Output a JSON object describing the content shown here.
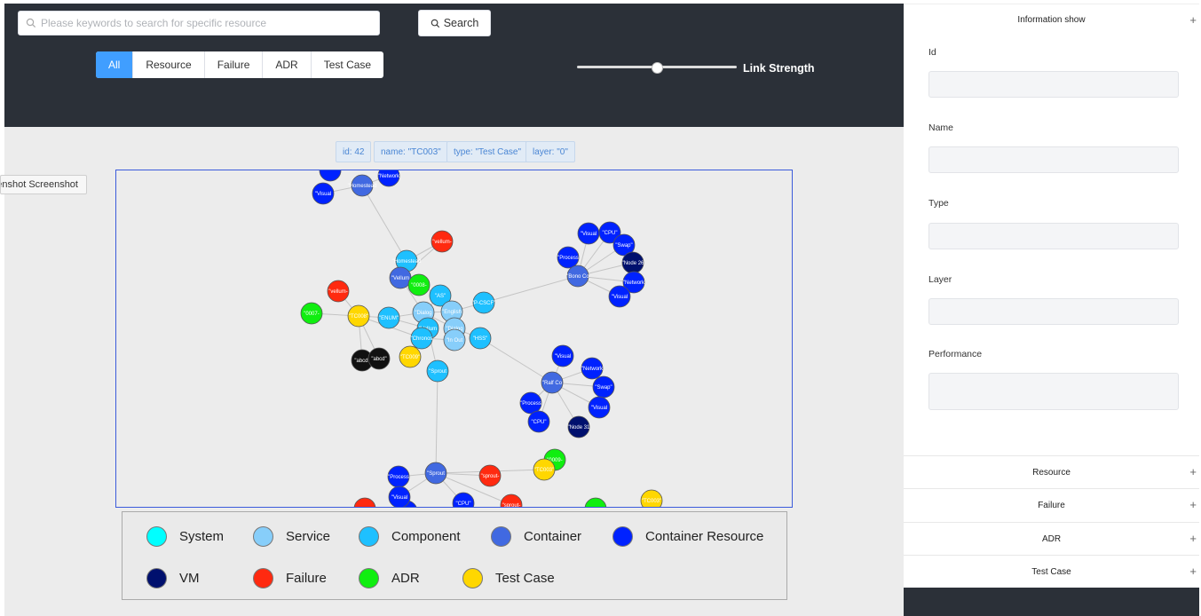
{
  "search": {
    "placeholder": "Please keywords to search for specific resource",
    "button_label": "Search"
  },
  "filter_tabs": [
    {
      "label": "All",
      "active": true
    },
    {
      "label": "Resource",
      "active": false
    },
    {
      "label": "Failure",
      "active": false
    },
    {
      "label": "ADR",
      "active": false
    },
    {
      "label": "Test Case",
      "active": false
    }
  ],
  "link_strength": {
    "label": "Link Strength",
    "value": 0.5
  },
  "node_info": [
    "id: 42",
    "name: \"TC003\"",
    "type: \"Test Case\"",
    "layer: \"0\""
  ],
  "tooltip": "Screenshot Screenshot",
  "colors": {
    "System": "#00ffff",
    "Service": "#87cefa",
    "Component": "#1ec0ff",
    "Container": "#4169e1",
    "Container Resource": "#0022ff",
    "VM": "#00106e",
    "Failure": "#ff2a10",
    "ADR": "#10ee10",
    "Test Case": "#ffd700"
  },
  "graph_nodes": [
    {
      "label": "\"Visual",
      "type": "Container Resource"
    },
    {
      "label": "\"Homestead",
      "type": "Container"
    },
    {
      "label": "\"Network",
      "type": "Container Resource"
    },
    {
      "label": "\"vellum-",
      "type": "Failure"
    },
    {
      "label": "\"Homestead",
      "type": "Component"
    },
    {
      "label": "\"Vellum",
      "type": "Container"
    },
    {
      "label": "\"0008-",
      "type": "ADR"
    },
    {
      "label": "\"vellum-",
      "type": "Failure"
    },
    {
      "label": "\"0007-",
      "type": "ADR"
    },
    {
      "label": "\"TC008\"",
      "type": "Test Case"
    },
    {
      "label": "\"ENUM\"",
      "type": "Component"
    },
    {
      "label": "\"AS\"",
      "type": "Component"
    },
    {
      "label": "\"P-CSCF\"",
      "type": "Component"
    },
    {
      "label": "\"Dialog",
      "type": "Service"
    },
    {
      "label": "\"English",
      "type": "Service"
    },
    {
      "label": "\"Vellum",
      "type": "Component"
    },
    {
      "label": "\"Dialog",
      "type": "Service"
    },
    {
      "label": "\"Chronos",
      "type": "Component"
    },
    {
      "label": "\"In Out",
      "type": "Service"
    },
    {
      "label": "\"HSS\"",
      "type": "Component"
    },
    {
      "label": "\"abcd\"",
      "type": "Other"
    },
    {
      "label": "\"abcd\"",
      "type": "Other"
    },
    {
      "label": "\"TC009\"",
      "type": "Test Case"
    },
    {
      "label": "\"Sprout",
      "type": "Component"
    },
    {
      "label": "\"Visual",
      "type": "Container Resource"
    },
    {
      "label": "\"CPU\"",
      "type": "Container Resource"
    },
    {
      "label": "\"Swap\"",
      "type": "Container Resource"
    },
    {
      "label": "\"Process",
      "type": "Container Resource"
    },
    {
      "label": "\"Node 26",
      "type": "VM"
    },
    {
      "label": "\"Bono Co",
      "type": "Container"
    },
    {
      "label": "\"Network",
      "type": "Container Resource"
    },
    {
      "label": "\"Visual",
      "type": "Container Resource"
    },
    {
      "label": "\"Visual",
      "type": "Container Resource"
    },
    {
      "label": "\"Network",
      "type": "Container Resource"
    },
    {
      "label": "\"Ralf Co",
      "type": "Container"
    },
    {
      "label": "\"Swap\"",
      "type": "Container Resource"
    },
    {
      "label": "\"Process",
      "type": "Container Resource"
    },
    {
      "label": "\"Visual",
      "type": "Container Resource"
    },
    {
      "label": "\"CPU\"",
      "type": "Container Resource"
    },
    {
      "label": "\"Node 31",
      "type": "VM"
    },
    {
      "label": "\"0009-",
      "type": "ADR"
    },
    {
      "label": "\"TC003\"",
      "type": "Test Case"
    },
    {
      "label": "\"Process",
      "type": "Container Resource"
    },
    {
      "label": "\"Sprout",
      "type": "Container"
    },
    {
      "label": "\"sprout-",
      "type": "Failure"
    },
    {
      "label": "\"Visual",
      "type": "Container Resource"
    },
    {
      "label": "\"CPU\"",
      "type": "Container Resource"
    },
    {
      "label": "\"sprout-",
      "type": "Failure"
    },
    {
      "label": "\"TC003\"",
      "type": "Test Case"
    }
  ],
  "legend": {
    "row1": [
      {
        "label": "System",
        "color": "#00ffff"
      },
      {
        "label": "Service",
        "color": "#87cefa"
      },
      {
        "label": "Component",
        "color": "#1ec0ff"
      },
      {
        "label": "Container",
        "color": "#4169e1"
      },
      {
        "label": "Container Resource",
        "color": "#0022ff"
      }
    ],
    "row2": [
      {
        "label": "VM",
        "color": "#00106e"
      },
      {
        "label": "Failure",
        "color": "#ff2a10"
      },
      {
        "label": "ADR",
        "color": "#10ee10"
      },
      {
        "label": "Test Case",
        "color": "#ffd700"
      }
    ]
  },
  "info_panel": {
    "title": "Information show",
    "fields": {
      "id": "Id",
      "name": "Name",
      "type": "Type",
      "layer": "Layer",
      "performance": "Performance"
    }
  },
  "accordions": [
    "Resource",
    "Failure",
    "ADR",
    "Test Case"
  ]
}
